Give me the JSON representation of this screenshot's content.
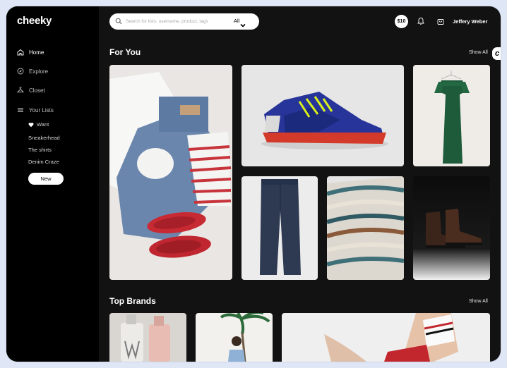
{
  "app": {
    "logo": "cheeky"
  },
  "sidebar": {
    "nav": [
      {
        "label": "Home",
        "icon": "home-icon",
        "active": true
      },
      {
        "label": "Explore",
        "icon": "compass-icon"
      },
      {
        "label": "Closet",
        "icon": "hanger-icon"
      },
      {
        "label": "Your Lists",
        "icon": "list-icon"
      }
    ],
    "lists": [
      {
        "label": "Want",
        "icon": "heart-icon"
      },
      {
        "label": "Sneakerhead"
      },
      {
        "label": "The shirts"
      },
      {
        "label": "Denim Craze"
      }
    ],
    "new_label": "New"
  },
  "header": {
    "search_placeholder": "Search for lists, username, product, tags",
    "filter_value": "All",
    "balance": "$10",
    "username": "Jeffery Weber"
  },
  "sections": {
    "for_you": {
      "title": "For You",
      "show_all": "Show All"
    },
    "top_brands": {
      "title": "Top Brands",
      "show_all": "Show All"
    }
  },
  "scroll_badge": "c",
  "colors": {
    "background": "#121212",
    "sidebar": "#000000",
    "accent": "#ffffff"
  }
}
